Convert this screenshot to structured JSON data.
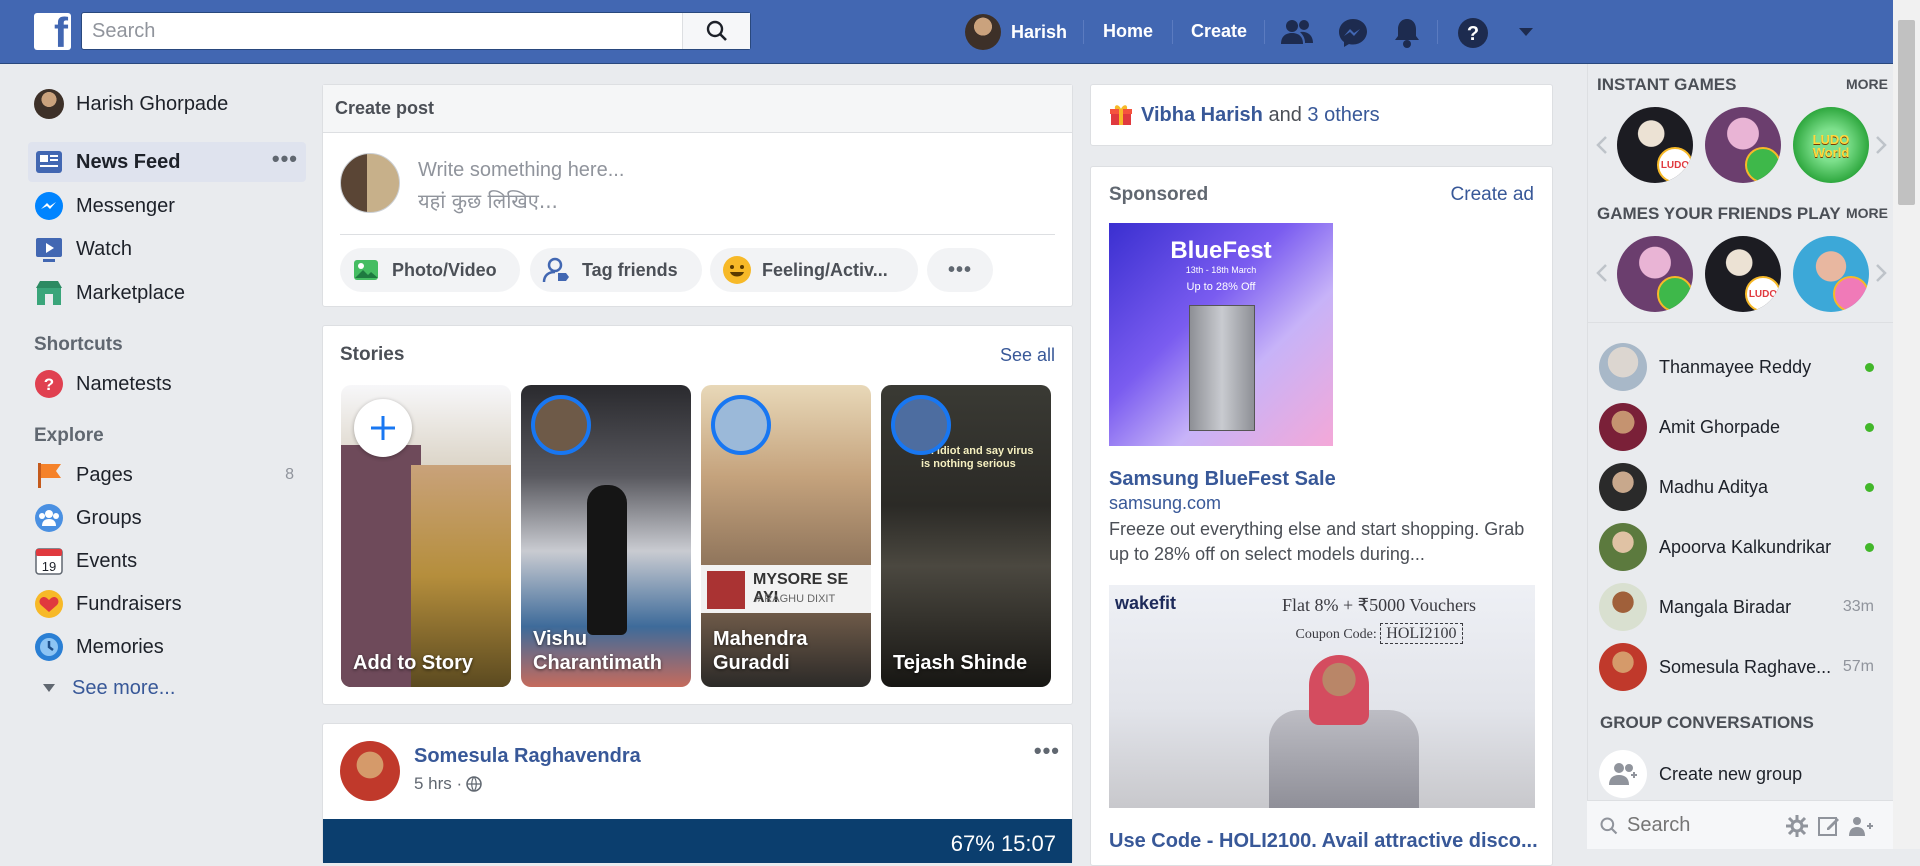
{
  "topbar": {
    "search_placeholder": "Search",
    "user_name": "Harish",
    "home": "Home",
    "create": "Create"
  },
  "left": {
    "profile_name": "Harish Ghorpade",
    "items": [
      {
        "label": "News Feed",
        "icon": "news-feed-icon"
      },
      {
        "label": "Messenger",
        "icon": "messenger-icon"
      },
      {
        "label": "Watch",
        "icon": "watch-icon"
      }
    ],
    "marketplace": "Marketplace",
    "shortcuts_title": "Shortcuts",
    "nametests": "Nametests",
    "explore_title": "Explore",
    "pages": "Pages",
    "pages_count": "8",
    "groups": "Groups",
    "events": "Events",
    "fundraisers": "Fundraisers",
    "memories": "Memories",
    "see_more": "See more..."
  },
  "composer": {
    "title": "Create post",
    "placeholder_en": "Write something here...",
    "placeholder_hi": "यहां कुछ लिखिए...",
    "actions": [
      "Photo/Video",
      "Tag friends",
      "Feeling/Activ..."
    ]
  },
  "stories": {
    "title": "Stories",
    "see_all": "See all",
    "items": [
      "Add to Story",
      "Vishu Charantimath",
      "Mahendra Guraddi",
      "Tejash Shinde"
    ],
    "mysore_title": "MYSORE SE AYI",
    "mysore_artist": "♫ RAGHU DIXIT",
    "tejash_caption": "an idiot and say virus is nothing serious"
  },
  "post": {
    "author": "Somesula Raghavendra",
    "time": "5 hrs ·",
    "status_bar": "67%  15:07"
  },
  "right": {
    "birthday_name": "Vibha Harish",
    "birthday_and": " and ",
    "birthday_others": "3 others",
    "sponsored": "Sponsored",
    "create_ad": "Create ad",
    "ad1_banner_title": "BlueFest",
    "ad1_banner_date": "13th - 18th March",
    "ad1_banner_offer": "Up to 28% Off",
    "ad1_title": "Samsung BlueFest Sale",
    "ad1_domain": "samsung.com",
    "ad1_desc": "Freeze out everything else and start shopping. Grab up to 28% off on select models during...",
    "ad2_brand": "wakefit",
    "ad2_offer": "Flat 8% + ₹5000 Vouchers",
    "ad2_code_label": "Coupon Code:",
    "ad2_code": "HOLI2100",
    "ad2_title": "Use Code - HOLI2100. Avail attractive disco..."
  },
  "rail": {
    "instant_games": "INSTANT GAMES",
    "more": "MORE",
    "friends_games": "GAMES YOUR FRIENDS PLAY",
    "ludo_label": "LUDO",
    "ludo_world_label": "LUDO World",
    "contacts": [
      {
        "name": "Thanmayee Reddy",
        "status": "online"
      },
      {
        "name": "Amit Ghorpade",
        "status": "online"
      },
      {
        "name": "Madhu Aditya",
        "status": "online"
      },
      {
        "name": "Apoorva Kalkundrikar",
        "status": "online"
      },
      {
        "name": "Mangala Biradar",
        "status": "33m"
      },
      {
        "name": "Somesula Raghave...",
        "status": "57m"
      }
    ],
    "group_conversations": "GROUP CONVERSATIONS",
    "create_group": "Create new group",
    "search_placeholder": "Search"
  },
  "colors": {
    "brand": "#4267b2",
    "link": "#385898",
    "online": "#42b72a"
  }
}
